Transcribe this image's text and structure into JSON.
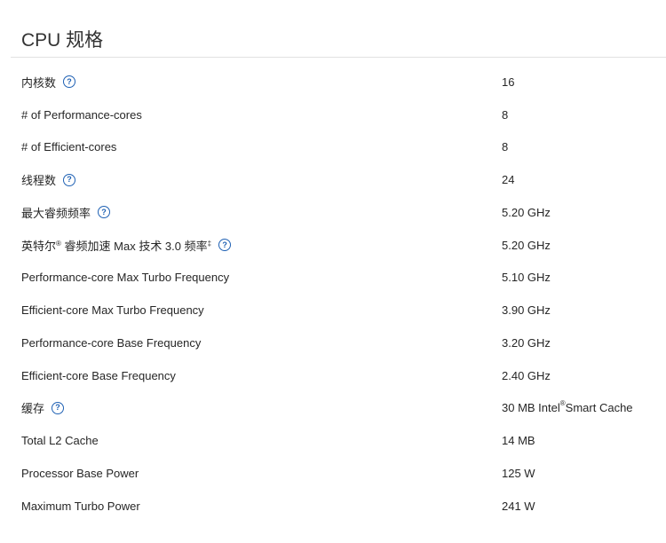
{
  "title": "CPU 规格",
  "icons": {
    "help": "question-circle-icon"
  },
  "colors": {
    "help_icon": "#1f61b4",
    "text": "#262626",
    "divider": "#e2e2e2"
  },
  "specs": [
    {
      "label": "内核数",
      "value": "16",
      "help": true
    },
    {
      "label": "# of Performance-cores",
      "value": "8",
      "help": false
    },
    {
      "label": "# of Efficient-cores",
      "value": "8",
      "help": false
    },
    {
      "label": "线程数",
      "value": "24",
      "help": true
    },
    {
      "label": "最大睿频频率",
      "value": "5.20 GHz",
      "help": true
    },
    {
      "label_pre": "英特尔",
      "label_sup": "®",
      "label_mid": " 睿频加速 Max 技术 3.0 频率",
      "label_sup2": "‡",
      "value": "5.20 GHz",
      "help": true
    },
    {
      "label": "Performance-core Max Turbo Frequency",
      "value": "5.10 GHz",
      "help": false
    },
    {
      "label": "Efficient-core Max Turbo Frequency",
      "value": "3.90 GHz",
      "help": false
    },
    {
      "label": "Performance-core Base Frequency",
      "value": "3.20 GHz",
      "help": false
    },
    {
      "label": "Efficient-core Base Frequency",
      "value": "2.40 GHz",
      "help": false
    },
    {
      "label": "缓存",
      "value_pre": "30 MB Intel",
      "value_sup": "®",
      "value_post": " Smart Cache",
      "help": true
    },
    {
      "label": "Total L2 Cache",
      "value": "14 MB",
      "help": false
    },
    {
      "label": "Processor Base Power",
      "value": "125 W",
      "help": false
    },
    {
      "label": "Maximum Turbo Power",
      "value": "241 W",
      "help": false
    }
  ]
}
